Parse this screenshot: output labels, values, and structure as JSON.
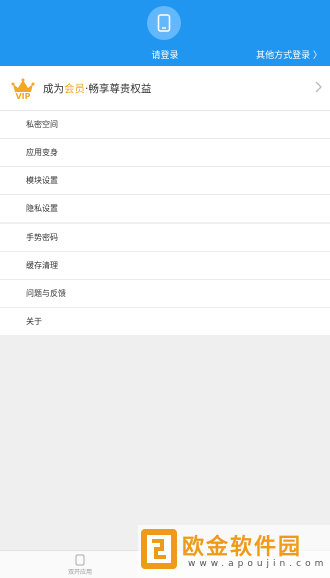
{
  "header": {
    "login_label": "请登录",
    "other_login_label": "其他方式登录 〉",
    "avatar_icon": "phone-icon",
    "bg_color": "#2196f0"
  },
  "vip": {
    "icon": "vip-crown-icon",
    "text_prefix": "成为",
    "text_highlight": "会员",
    "text_suffix": "·畅享尊贵权益",
    "highlight_color": "#f5a623"
  },
  "menu_group1": {
    "items": [
      {
        "label": "私密空间"
      },
      {
        "label": "应用变身"
      },
      {
        "label": "模块设置"
      },
      {
        "label": "隐私设置"
      }
    ]
  },
  "menu_group2": {
    "items": [
      {
        "label": "手势密码"
      },
      {
        "label": "缓存清理"
      },
      {
        "label": "问题与反馈"
      },
      {
        "label": "关于"
      }
    ]
  },
  "tabbar": {
    "tab_label": "双开应用",
    "tab_icon": "app-icon"
  },
  "watermark": {
    "title": "欧金软件园",
    "url": "www.apoujin.com",
    "color": "#f09a1a"
  }
}
